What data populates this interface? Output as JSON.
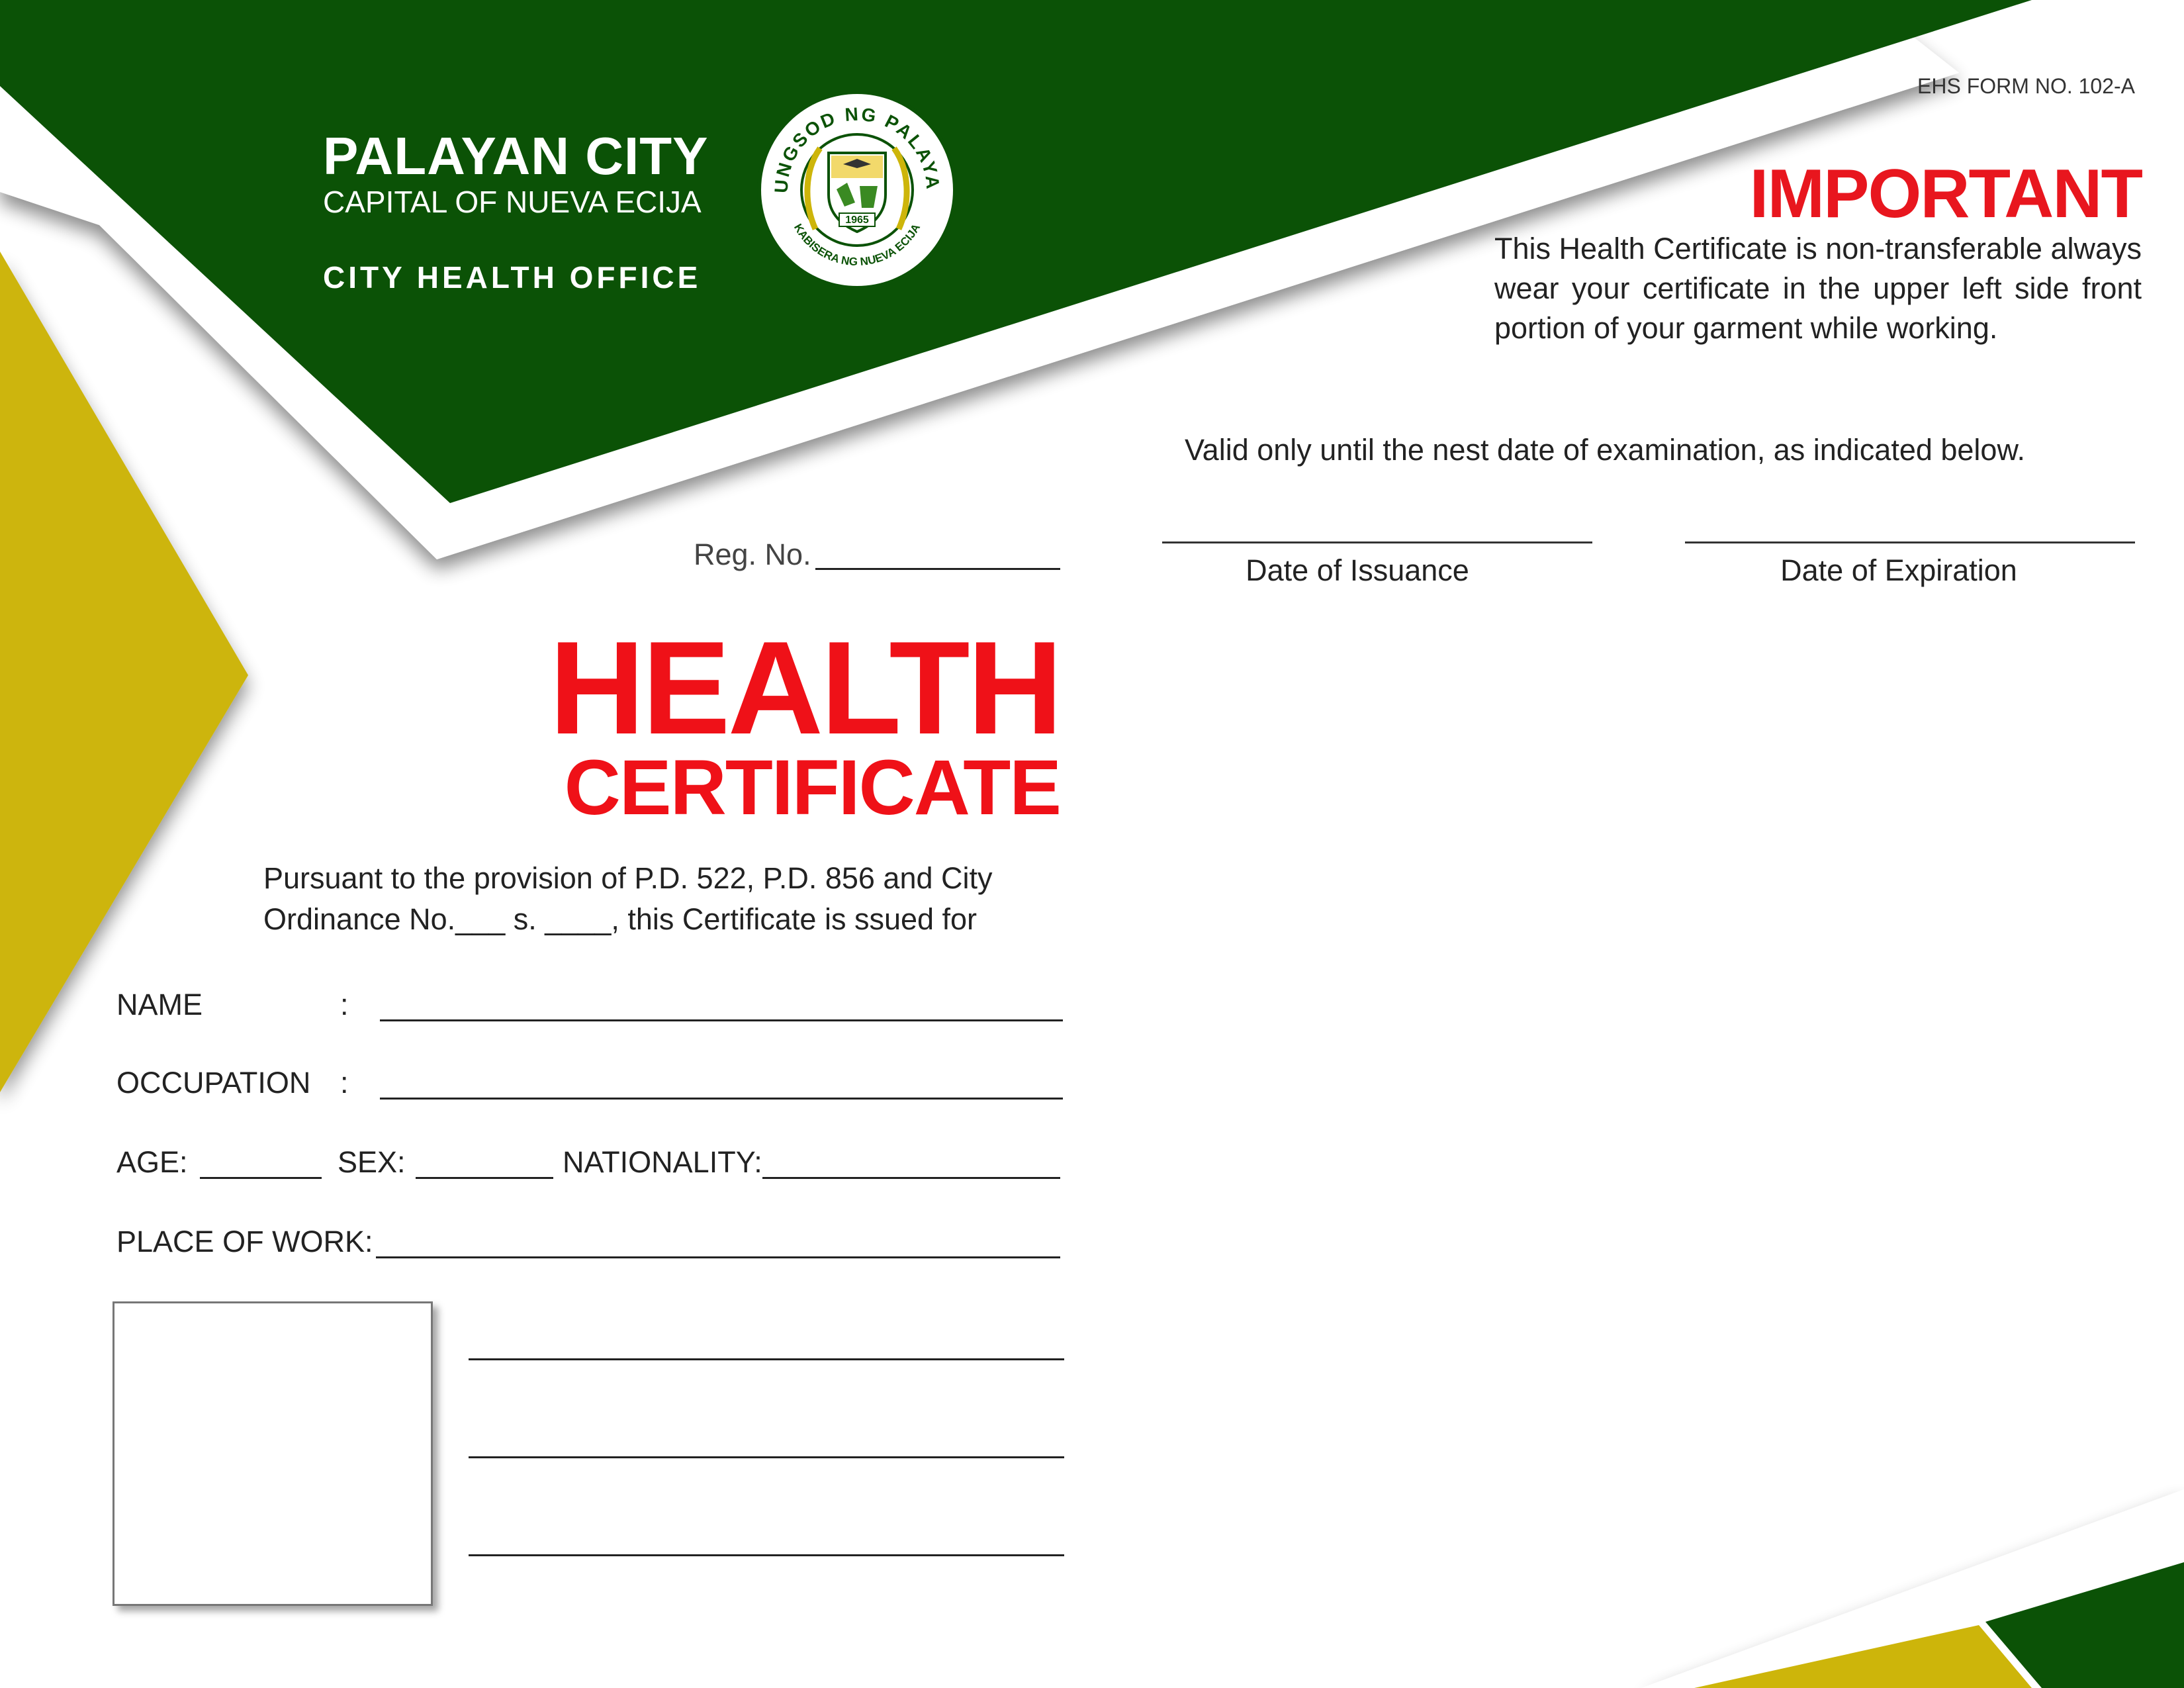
{
  "header": {
    "city": "PALAYAN CITY",
    "subtitle": "CAPITAL OF NUEVA ECIJA",
    "office": "CITY HEALTH OFFICE",
    "seal": {
      "top_text": "LUNGSOD NG PALAYAN",
      "bottom_text": "KABISERA NG NUEVA ECIJA",
      "year": "1965"
    }
  },
  "colors": {
    "green": "#0b5206",
    "olive": "#cdb50a",
    "red": "#ef1118"
  },
  "right_panel": {
    "form_no": "EHS FORM NO. 102-A",
    "important_title": "IMPORTANT",
    "important_text": "This Health Certificate is non-transferable always wear your certificate in the upper left side front portion of your garment while working.",
    "valid_text": "Valid only until the nest date of examination, as indicated below.",
    "date_issuance_label": "Date of Issuance",
    "date_expiration_label": "Date of Expiration"
  },
  "certificate": {
    "reg_no_label": "Reg. No.",
    "title_line1": "HEALTH",
    "title_line2": "CERTIFICATE",
    "pursuant_line1": "Pursuant to the provision of P.D. 522, P.D. 856 and City",
    "pursuant_line2": "Ordinance No.___ s. ____, this Certificate is ssued for",
    "fields": {
      "name_label": "NAME",
      "occupation_label": "OCCUPATION",
      "colon": ":",
      "age_label": "AGE:",
      "sex_label": "SEX:",
      "nationality_label": "NATIONALITY:",
      "place_of_work_label": "PLACE OF WORK:"
    }
  }
}
